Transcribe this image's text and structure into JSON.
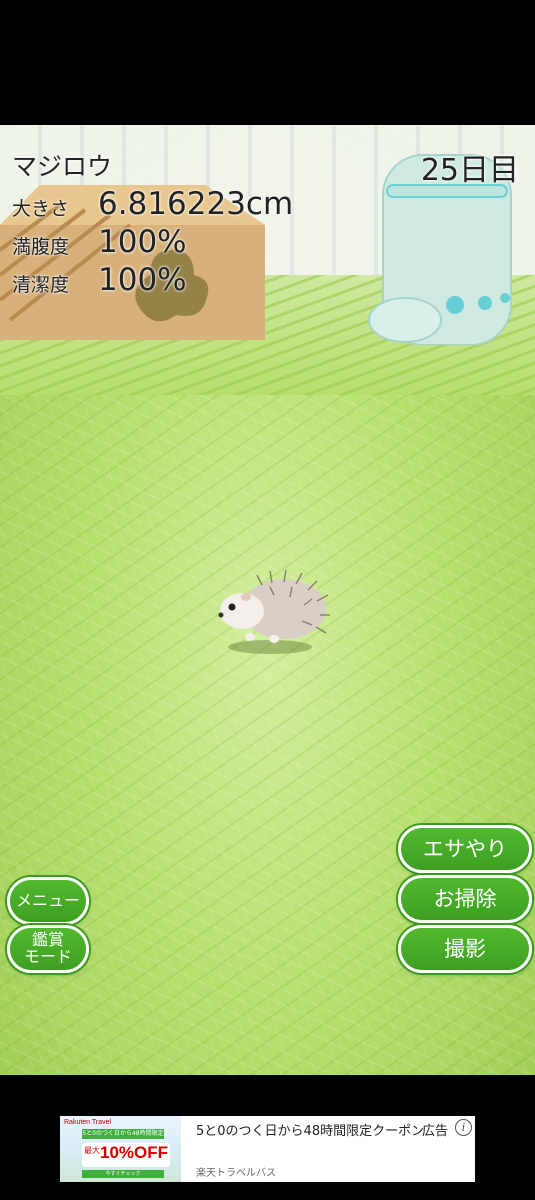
{
  "pet": {
    "name": "マジロウ",
    "day": "25日目",
    "stats": [
      {
        "label": "大きさ",
        "value": "6.816223cm"
      },
      {
        "label": "満腹度",
        "value": "100%"
      },
      {
        "label": "清潔度",
        "value": "100%"
      }
    ]
  },
  "buttons": {
    "feed": "エサやり",
    "clean": "お掃除",
    "photo": "撮影",
    "menu": "メニュー",
    "viewing_mode_line1": "鑑賞",
    "viewing_mode_line2": "モード"
  },
  "ad": {
    "brand": "Rakuten Travel",
    "banner_text": "5と0のつく日から48時間限定",
    "best_label": "最大",
    "percent": "10%OFF",
    "campaign_text": "今すぐチェック",
    "title": "5と0のつく日から48時間限定クーポン",
    "label": "広告",
    "info_icon": "i",
    "advertiser": "楽天トラベルバス"
  },
  "colors": {
    "button_green": "#4cae2a",
    "grass": "#b8e070"
  }
}
